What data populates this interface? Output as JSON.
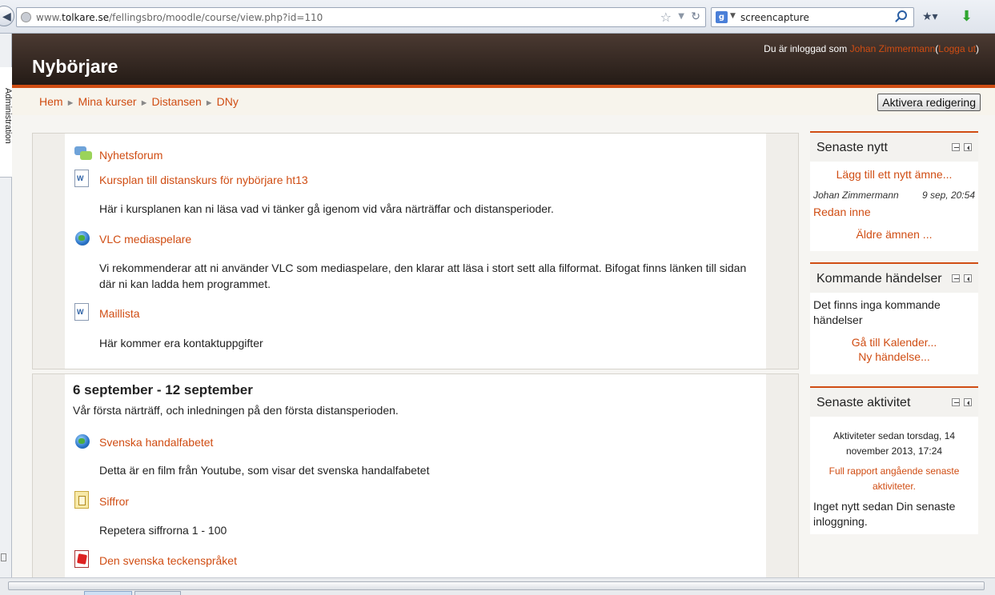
{
  "browser": {
    "url_prefix": "www.",
    "url_host": "tolkare.se",
    "url_path": "/fellingsbro/moodle/course/view.php?id=110",
    "search_engine_icon": "google-icon",
    "search_query": "screencapture"
  },
  "sidebar": {
    "vertical_label": "Administration"
  },
  "header": {
    "site_title": "Nybörjare",
    "login_prefix": "Du är inloggad som",
    "user_name": "Johan Zimmermann",
    "open_paren": "(",
    "logout": "Logga ut",
    "close_paren": ")"
  },
  "breadcrumb": [
    "Hem",
    "Mina kurser",
    "Distansen",
    "DNy"
  ],
  "edit_button": "Aktivera redigering",
  "section0": {
    "activities": [
      {
        "icon": "forum-icon",
        "name": "Nyhetsforum",
        "desc": ""
      },
      {
        "icon": "word-doc-icon",
        "name": "Kursplan till distanskurs för nybörjare ht13",
        "desc": "Här i kursplanen kan ni läsa vad vi tänker gå igenom vid våra närträffar och distansperioder."
      },
      {
        "icon": "url-globe-icon",
        "name": "VLC mediaspelare",
        "desc": "Vi rekommenderar att ni använder VLC som mediaspelare, den klarar att läsa i stort sett alla filformat. Bifogat finns länken till sidan där ni kan ladda hem programmet."
      },
      {
        "icon": "word-doc-icon",
        "name": "Maillista",
        "desc": "Här kommer era kontaktuppgifter"
      }
    ]
  },
  "section1": {
    "title": "6 september - 12 september",
    "summary": "Vår första närträff, och inledningen på den första distansperioden.",
    "activities": [
      {
        "icon": "url-globe-icon",
        "name": "Svenska handalfabetet",
        "desc": "Detta är en film från Youtube, som visar det svenska handalfabetet"
      },
      {
        "icon": "lesson-icon",
        "name": "Siffror",
        "desc": "Repetera siffrorna 1 - 100"
      },
      {
        "icon": "pdf-icon",
        "name": "Den svenska teckenspråket",
        "desc": ""
      }
    ]
  },
  "blocks": {
    "news": {
      "title": "Senaste nytt",
      "add_topic": "Lägg till ett nytt ämne...",
      "post_author": "Johan Zimmermann",
      "post_date": "9 sep, 20:54",
      "post_title": "Redan inne",
      "older": "Äldre ämnen ..."
    },
    "events": {
      "title": "Kommande händelser",
      "none": "Det finns inga kommande händelser",
      "calendar": "Gå till Kalender...",
      "new_event": "Ny händelse..."
    },
    "activity": {
      "title": "Senaste aktivitet",
      "since": "Aktiviteter sedan torsdag, 14 november 2013, 17:24",
      "full_report": "Full rapport angående senaste aktiviteter.",
      "nothing_new": "Inget nytt sedan Din senaste inloggning."
    }
  },
  "colors": {
    "accent": "#d04d13",
    "header_dark": "#2e231d"
  }
}
